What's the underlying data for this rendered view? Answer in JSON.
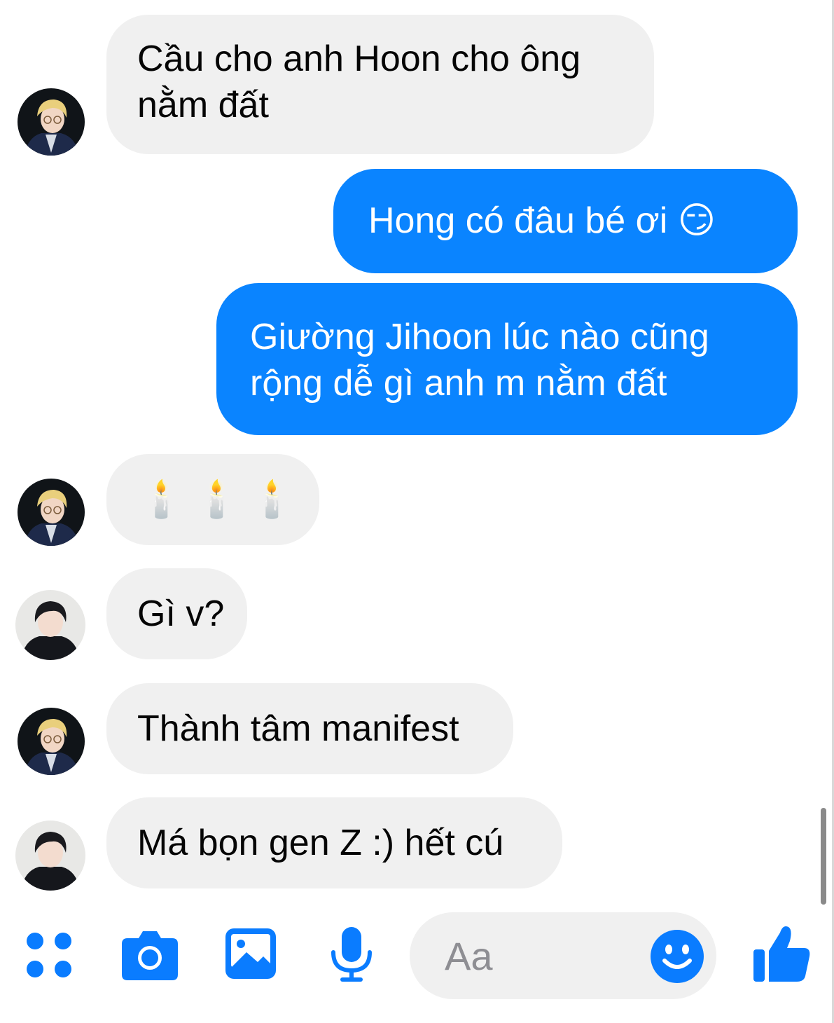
{
  "messages": [
    {
      "text_line1": "Cầu cho anh Hoon cho ông",
      "text_line2": "nằm đất"
    },
    {
      "text": "Hong có đâu bé ơi 😏"
    },
    {
      "text_line1": "Giường Jihoon lúc nào cũng",
      "text_line2": "rộng dễ gì anh m nằm đất"
    },
    {
      "text": "🕯️ 🕯️ 🕯️"
    },
    {
      "text": "Gì v?"
    },
    {
      "text": "Thành tâm manifest"
    },
    {
      "text": "Má bọn gen Z :) hết cú"
    }
  ],
  "composer": {
    "placeholder": "Aa"
  },
  "icons": {
    "apps": "apps-icon",
    "camera": "camera-icon",
    "gallery": "image-icon",
    "mic": "microphone-icon",
    "emoji": "smiley-icon",
    "like": "thumbs-up-icon"
  },
  "colors": {
    "outgoing_bubble": "#0a84ff",
    "incoming_bubble": "#f0f0f0",
    "accent": "#0a7cff"
  }
}
